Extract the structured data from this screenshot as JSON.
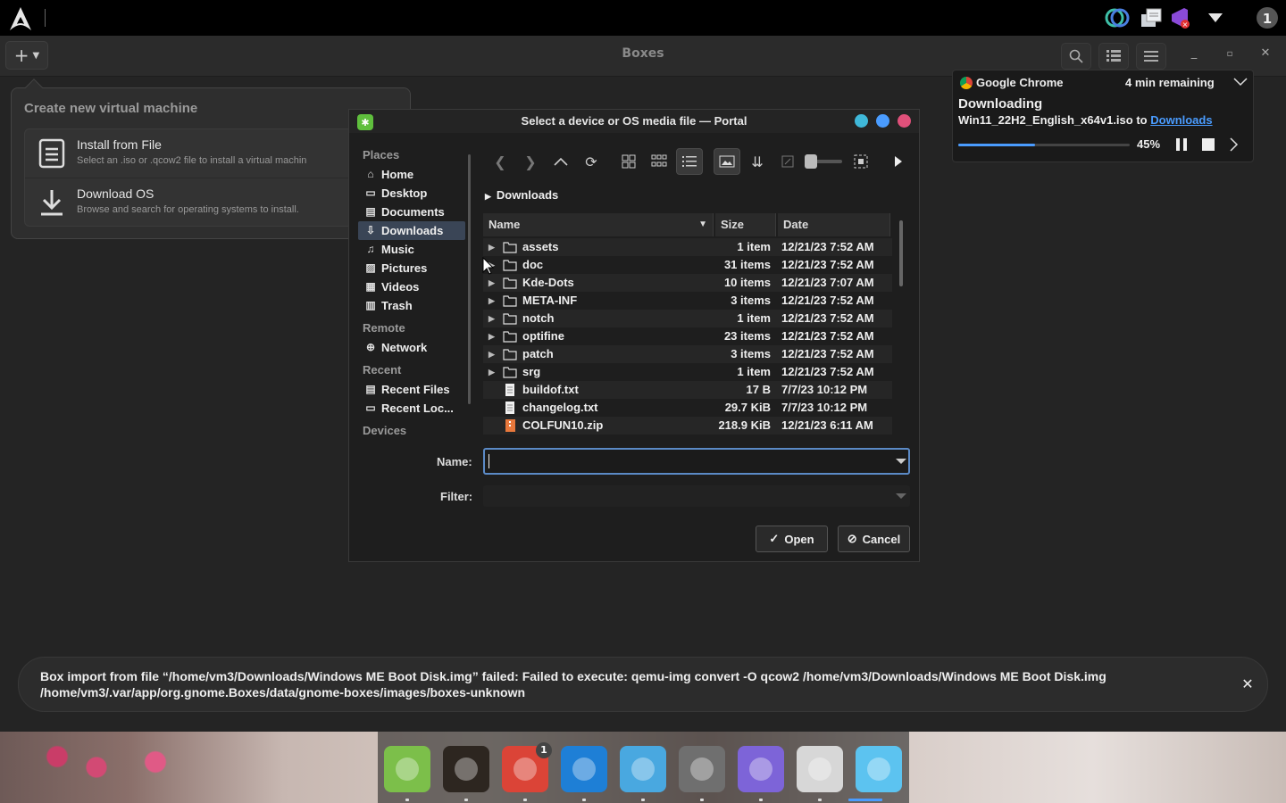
{
  "topbar": {
    "tray": [
      "sync-icon",
      "notes-icon",
      "visual-studio-icon",
      "dropdown-icon",
      "notification-count-icon"
    ],
    "notification_count": "1"
  },
  "boxes": {
    "title": "Boxes",
    "new_button": "+",
    "create_popover": {
      "title": "Create new virtual machine",
      "items": [
        {
          "label": "Install from File",
          "desc": "Select an .iso or .qcow2 file to install a virtual machin"
        },
        {
          "label": "Download OS",
          "desc": "Browse and search for operating systems to install."
        }
      ]
    }
  },
  "dialog": {
    "title": "Select a device or OS media file — Portal",
    "title_dots": [
      "#3fb8d9",
      "#4a9cff",
      "#e0507a"
    ],
    "places": {
      "sections": [
        {
          "title": "Places",
          "items": [
            {
              "label": "Home",
              "icon": "home-icon",
              "glyph": "⌂"
            },
            {
              "label": "Desktop",
              "icon": "desktop-icon",
              "glyph": "▭"
            },
            {
              "label": "Documents",
              "icon": "documents-icon",
              "glyph": "▤"
            },
            {
              "label": "Downloads",
              "icon": "downloads-icon",
              "glyph": "⇩",
              "selected": true
            },
            {
              "label": "Music",
              "icon": "music-icon",
              "glyph": "♫"
            },
            {
              "label": "Pictures",
              "icon": "pictures-icon",
              "glyph": "▨"
            },
            {
              "label": "Videos",
              "icon": "videos-icon",
              "glyph": "▦"
            },
            {
              "label": "Trash",
              "icon": "trash-icon",
              "glyph": "▥"
            }
          ]
        },
        {
          "title": "Remote",
          "items": [
            {
              "label": "Network",
              "icon": "network-icon",
              "glyph": "⊕"
            }
          ]
        },
        {
          "title": "Recent",
          "items": [
            {
              "label": "Recent Files",
              "icon": "recent-files-icon",
              "glyph": "▤"
            },
            {
              "label": "Recent Loc...",
              "icon": "recent-locations-icon",
              "glyph": "▭"
            }
          ]
        },
        {
          "title": "Devices",
          "items": []
        }
      ]
    },
    "toolbar": [
      "back-icon",
      "forward-icon",
      "up-icon",
      "reload-icon",
      "icon-view-icon",
      "compact-view-icon",
      "details-view-icon",
      "preview-icon",
      "sort-icon",
      "zoom-icon",
      "zoom-slider",
      "fit-icon",
      "more-icon"
    ],
    "breadcrumb": "Downloads",
    "columns": {
      "name": "Name",
      "size": "Size",
      "date": "Date"
    },
    "files": [
      {
        "name": "assets",
        "type": "folder",
        "size": "1 item",
        "date": "12/21/23 7:52 AM"
      },
      {
        "name": "doc",
        "type": "folder",
        "size": "31 items",
        "date": "12/21/23 7:52 AM"
      },
      {
        "name": "Kde-Dots",
        "type": "folder",
        "size": "10 items",
        "date": "12/21/23 7:07 AM"
      },
      {
        "name": "META-INF",
        "type": "folder",
        "size": "3 items",
        "date": "12/21/23 7:52 AM"
      },
      {
        "name": "notch",
        "type": "folder",
        "size": "1 item",
        "date": "12/21/23 7:52 AM"
      },
      {
        "name": "optifine",
        "type": "folder",
        "size": "23 items",
        "date": "12/21/23 7:52 AM"
      },
      {
        "name": "patch",
        "type": "folder",
        "size": "3 items",
        "date": "12/21/23 7:52 AM"
      },
      {
        "name": "srg",
        "type": "folder",
        "size": "1 item",
        "date": "12/21/23 7:52 AM"
      },
      {
        "name": "buildof.txt",
        "type": "text",
        "size": "17 B",
        "date": "7/7/23 10:12 PM"
      },
      {
        "name": "changelog.txt",
        "type": "text",
        "size": "29.7 KiB",
        "date": "7/7/23 10:12 PM"
      },
      {
        "name": "COLFUN10.zip",
        "type": "archive",
        "size": "218.9 KiB",
        "date": "12/21/23 6:11 AM"
      }
    ],
    "name_label": "Name:",
    "name_value": "",
    "filter_label": "Filter:",
    "filter_value": "",
    "open_label": "Open",
    "cancel_label": "Cancel"
  },
  "download": {
    "app": "Google Chrome",
    "remaining": "4 min remaining",
    "status": "Downloading",
    "file": "Win11_22H2_English_x64v1.iso",
    "to": "to",
    "folder_link": "Downloads",
    "progress": 0.45,
    "percent_label": "45%"
  },
  "toast": {
    "message": "Box import from file “/home/vm3/Downloads/Windows ME Boot Disk.img” failed: Failed to execute: qemu-img convert -O qcow2 /home/vm3/Downloads/Windows ME Boot Disk.img /home/vm3/.var/app/org.gnome.Boxes/data/gnome-boxes/images/boxes-unknown"
  },
  "dock": {
    "apps": [
      {
        "name": "minecraft-launcher",
        "color": "#7cbf4a",
        "badge": ""
      },
      {
        "name": "terminal",
        "color": "#2d2620",
        "badge": ""
      },
      {
        "name": "google-chrome",
        "color": "#db4437",
        "badge": "1"
      },
      {
        "name": "visual-studio-code",
        "color": "#1e7fd6",
        "badge": ""
      },
      {
        "name": "dolphin-emulator",
        "color": "#49a8e0",
        "badge": ""
      },
      {
        "name": "cube-app",
        "color": "#6f6f6f",
        "badge": ""
      },
      {
        "name": "gradient-app",
        "color": "#7d64d8",
        "badge": ""
      },
      {
        "name": "roblox",
        "color": "#d7d7d7",
        "badge": ""
      },
      {
        "name": "gnome-boxes",
        "color": "#5cc3f0",
        "badge": ""
      }
    ],
    "active_index": 8
  },
  "colors": {
    "accent": "#4a9cff",
    "selection": "#3a4556"
  }
}
